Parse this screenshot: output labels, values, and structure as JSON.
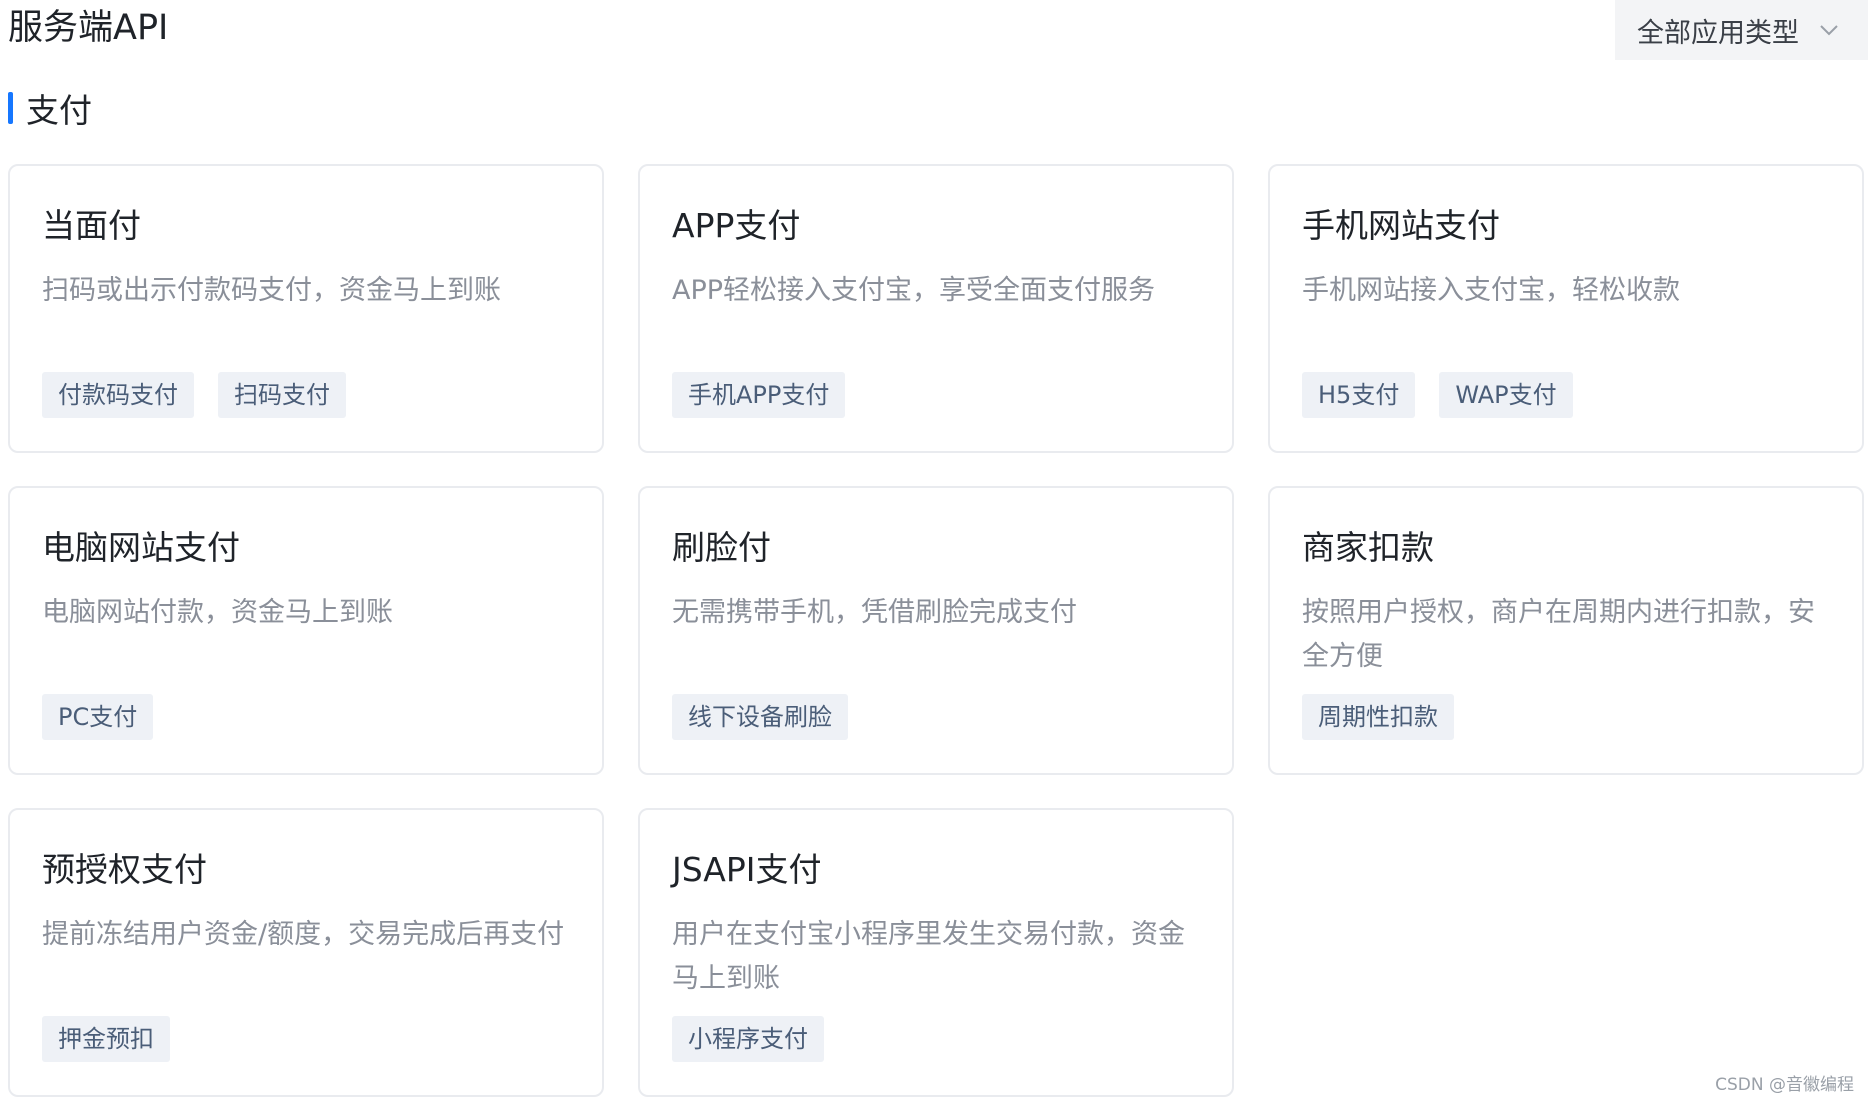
{
  "header": {
    "title": "服务端API",
    "type_select": "全部应用类型"
  },
  "section": {
    "title": "支付"
  },
  "cards": [
    {
      "title": "当面付",
      "desc": "扫码或出示付款码支付，资金马上到账",
      "tags": [
        "付款码支付",
        "扫码支付"
      ]
    },
    {
      "title": "APP支付",
      "desc": "APP轻松接入支付宝，享受全面支付服务",
      "tags": [
        "手机APP支付"
      ]
    },
    {
      "title": "手机网站支付",
      "desc": "手机网站接入支付宝，轻松收款",
      "tags": [
        "H5支付",
        "WAP支付"
      ]
    },
    {
      "title": "电脑网站支付",
      "desc": "电脑网站付款，资金马上到账",
      "tags": [
        "PC支付"
      ]
    },
    {
      "title": "刷脸付",
      "desc": "无需携带手机，凭借刷脸完成支付",
      "tags": [
        "线下设备刷脸"
      ]
    },
    {
      "title": "商家扣款",
      "desc": "按照用户授权，商户在周期内进行扣款，安全方便",
      "tags": [
        "周期性扣款"
      ]
    },
    {
      "title": "预授权支付",
      "desc": "提前冻结用户资金/额度，交易完成后再支付",
      "tags": [
        "押金预扣"
      ]
    },
    {
      "title": "JSAPI支付",
      "desc": "用户在支付宝小程序里发生交易付款，资金马上到账",
      "tags": [
        "小程序支付"
      ]
    }
  ],
  "watermark": "CSDN @音徽编程",
  "colors": {
    "accent": "#1677ff",
    "tag_bg": "#eef1f6",
    "tag_text": "#4a5d78"
  },
  "icons": {
    "type_select": "chevron-down-icon"
  }
}
